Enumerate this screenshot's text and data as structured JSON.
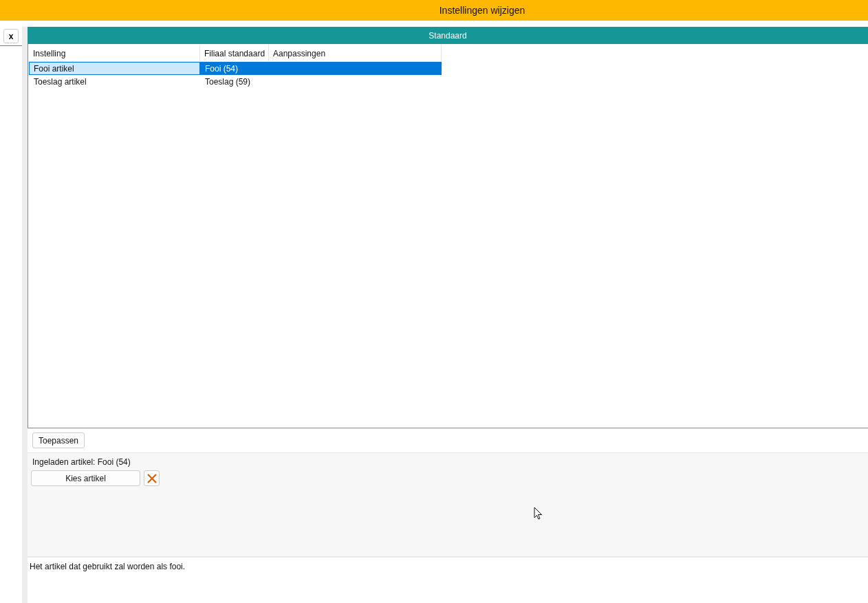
{
  "window": {
    "title": "Instellingen wijzigen"
  },
  "side": {
    "close_label": "x"
  },
  "panel": {
    "title": "Standaard"
  },
  "table": {
    "columns": [
      "Instelling",
      "Filiaal standaard",
      "Aanpassingen"
    ],
    "rows": [
      {
        "cells": [
          "Fooi artikel",
          "Fooi (54)",
          ""
        ],
        "selected": true
      },
      {
        "cells": [
          "Toeslag artikel",
          "Toeslag (59)",
          ""
        ],
        "selected": false
      }
    ]
  },
  "apply_button": "Toepassen",
  "editor": {
    "loaded_label": "Ingeladen artikel: Fooi (54)",
    "choose_button": "Kies artikel"
  },
  "description": "Het artikel dat gebruikt zal worden als fooi."
}
